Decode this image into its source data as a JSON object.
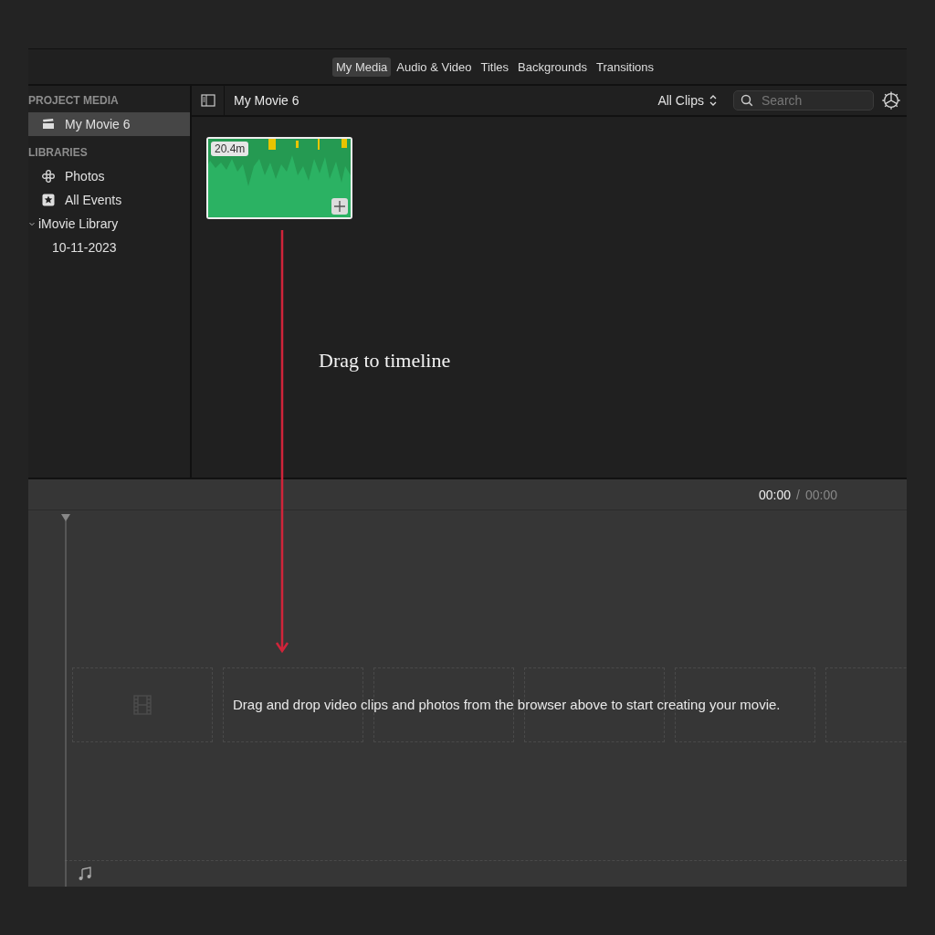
{
  "tabs": [
    {
      "label": "My Media",
      "selected": true
    },
    {
      "label": "Audio & Video",
      "selected": false
    },
    {
      "label": "Titles",
      "selected": false
    },
    {
      "label": "Backgrounds",
      "selected": false
    },
    {
      "label": "Transitions",
      "selected": false
    }
  ],
  "sidebar": {
    "sections": [
      {
        "heading": "PROJECT MEDIA",
        "items": [
          {
            "label": "My Movie 6",
            "kind": "project",
            "selected": true
          }
        ]
      },
      {
        "heading": "LIBRARIES",
        "items": [
          {
            "label": "Photos",
            "kind": "photos",
            "selected": false
          },
          {
            "label": "All Events",
            "kind": "events",
            "selected": false
          },
          {
            "label": "iMovie Library",
            "kind": "library",
            "selected": false,
            "expanded": true,
            "children": [
              {
                "label": "10-11-2023",
                "selected": false
              }
            ]
          }
        ]
      }
    ]
  },
  "browser": {
    "title": "My Movie 6",
    "filter": "All Clips",
    "search": {
      "placeholder": "Search"
    },
    "clips": [
      {
        "duration": "20.4m"
      }
    ]
  },
  "annotation": "Drag to timeline",
  "timeline": {
    "current_time": "00:00",
    "separator": "/",
    "total_time": "00:00",
    "message": "Drag and drop video clips and photos from the browser above to start creating your movie."
  }
}
